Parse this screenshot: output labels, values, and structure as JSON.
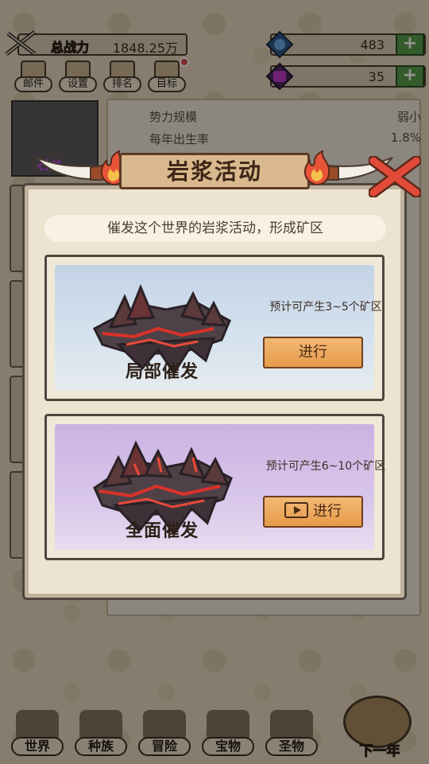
{
  "hud": {
    "power_label": "总战力",
    "power_value": "1848.25万",
    "resource_1_value": "483",
    "resource_2_value": "35",
    "plus_label": "+",
    "buttons": [
      "邮件",
      "设置",
      "排名",
      "目标"
    ]
  },
  "background": {
    "avatar_name": "石龙",
    "stats": [
      {
        "label": "势力规模",
        "value": "弱小"
      },
      {
        "label": "每年出生率",
        "value": "1.8%"
      }
    ]
  },
  "popup": {
    "title": "岩浆活动",
    "description": "催发这个世界的岩浆活动，形成矿区",
    "options": [
      {
        "title": "局部催发",
        "desc": "预计可产生3~5个矿区",
        "button": "进行",
        "has_video": false
      },
      {
        "title": "全面催发",
        "desc": "预计可产生6~10个矿区",
        "button": "进行",
        "has_video": true
      }
    ]
  },
  "nav": {
    "items": [
      "世界",
      "种族",
      "冒险",
      "宝物",
      "圣物"
    ],
    "next_year": "下一年"
  },
  "colors": {
    "accent_orange": "#e79a4a",
    "plus_green": "#5a9e4a",
    "partial_bg": "#c3d3e6",
    "full_bg": "#cab3e3",
    "lava_red": "#d8322a"
  }
}
